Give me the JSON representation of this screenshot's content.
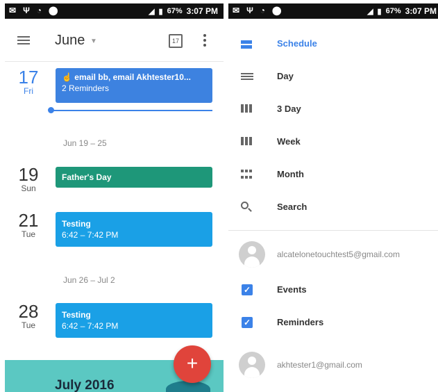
{
  "status_bar": {
    "left_icons": [
      "✉",
      "Ψ",
      "◔",
      "⬤"
    ],
    "battery": "67%",
    "time": "3:07 PM"
  },
  "schedule": {
    "header": {
      "month": "June",
      "calendar_icon_day": "17"
    },
    "days": [
      {
        "num": "17",
        "weekday": "Fri"
      },
      {
        "num": "19",
        "weekday": "Sun"
      },
      {
        "num": "21",
        "weekday": "Tue"
      },
      {
        "num": "28",
        "weekday": "Tue"
      }
    ],
    "events": [
      {
        "title": "email bb, email Akhtester10...",
        "subtitle": "2 Reminders"
      },
      {
        "title": "Father's Day"
      },
      {
        "title": "Testing",
        "subtitle": "6:42 – 7:42 PM"
      },
      {
        "title": "Testing",
        "subtitle": "6:42 – 7:42 PM"
      }
    ],
    "week_ranges": [
      "Jun 19 – 25",
      "Jun 26 – Jul 2"
    ],
    "month_banner": "July 2016",
    "fab_label": "+"
  },
  "drawer": {
    "views": [
      {
        "label": "Schedule",
        "icon": "schedule-icon"
      },
      {
        "label": "Day",
        "icon": "day-icon"
      },
      {
        "label": "3 Day",
        "icon": "three-day-icon"
      },
      {
        "label": "Week",
        "icon": "week-icon"
      },
      {
        "label": "Month",
        "icon": "month-icon"
      },
      {
        "label": "Search",
        "icon": "search-icon"
      }
    ],
    "accounts": [
      {
        "email": "alcatelonetouchtest5@gmail.com"
      },
      {
        "email": "akhtester1@gmail.com"
      }
    ],
    "calendars": [
      {
        "label": "Events",
        "checked": true
      },
      {
        "label": "Reminders",
        "checked": true
      }
    ],
    "accent_color": "#3b82e8"
  }
}
